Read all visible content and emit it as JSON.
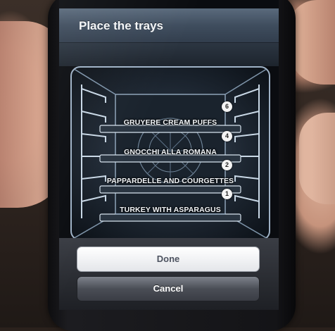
{
  "navbar": {
    "title": "Place the trays"
  },
  "trays": [
    {
      "position": "6",
      "label": "GRUYERE CREAM PUFFS"
    },
    {
      "position": "4",
      "label": "GNOCCHI ALLA ROMANA"
    },
    {
      "position": "2",
      "label": "PAPPARDELLE AND COURGETTES"
    },
    {
      "position": "1",
      "label": "TURKEY WITH ASPARAGUS"
    }
  ],
  "actions": {
    "done_label": "Done",
    "cancel_label": "Cancel"
  },
  "colors": {
    "navbar": "#3f4d5e",
    "oven_outline": "#9fb2c6",
    "done_text": "#4d5360",
    "cancel_bg": "#4a4e56"
  }
}
